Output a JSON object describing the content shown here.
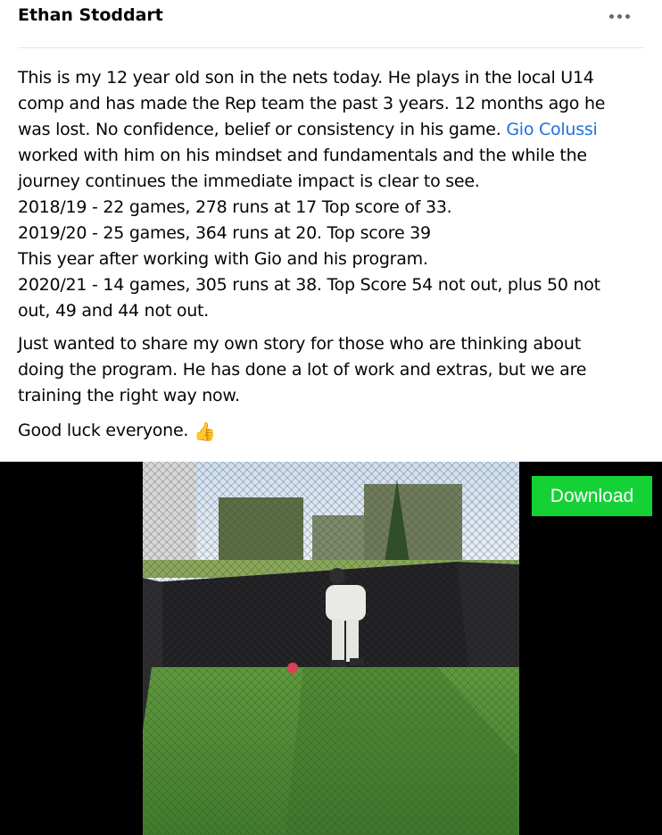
{
  "post": {
    "author": "Ethan Stoddart",
    "menu_icon": "more-horizontal-icon",
    "paragraph1_lines": [
      "This is my 12 year old son in the nets today. He plays in the local U14",
      "comp and has made the Rep team the past 3 years. 12 months ago he",
      "was lost. No confidence, belief or consistency in his game.",
      "worked with him on his mindset and fundamentals and the while the",
      "journey continues the immediate impact is clear to see.",
      "2018/19 - 22 games, 278 runs at 17 Top score of 33.",
      "2019/20 - 25 games, 364 runs at 20. Top score 39",
      "This year after working with Gio and his program.",
      "2020/21 - 14 games, 305 runs at 38. Top Score 54 not out, plus 50 not",
      "out, 49 and 44 not out."
    ],
    "mention": "Gio Colussi",
    "paragraph2_lines": [
      "Just wanted to share my own story for those who are thinking about",
      "doing the program. He has done a lot of work and extras, but we are",
      "training the right way now."
    ],
    "paragraph3": "Good luck everyone.",
    "paragraph3_emoji": "👍"
  },
  "video": {
    "download_label": "Download",
    "download_color": "#14d236"
  },
  "colors": {
    "mention": "#216fdb",
    "text": "#050505"
  }
}
